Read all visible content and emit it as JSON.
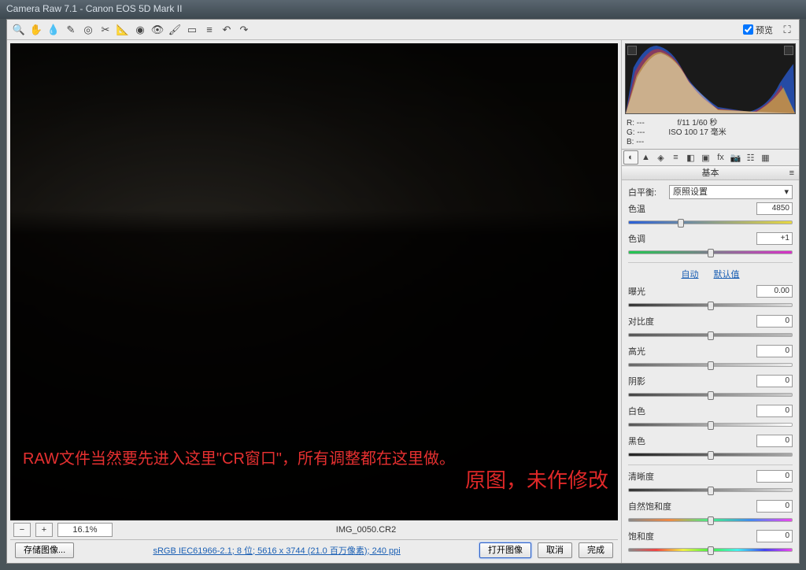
{
  "window_title": "Camera Raw 7.1  -  Canon EOS 5D Mark II",
  "preview_label": "预览",
  "zoom": "16.1%",
  "filename": "IMG_0050.CR2",
  "save_btn": "存储图像...",
  "color_link": "sRGB IEC61966-2.1; 8 位; 5616 x 3744 (21.0 百万像素); 240 ppi",
  "open_btn": "打开图像",
  "cancel_btn": "取消",
  "done_btn": "完成",
  "rgb": {
    "r": "R: ---",
    "g": "G: ---",
    "b": "B: ---"
  },
  "exif": {
    "line1": "f/11  1/60 秒",
    "line2": "ISO 100  17 毫米"
  },
  "panel_title": "基本",
  "wb": {
    "label": "白平衡:",
    "value": "原照设置"
  },
  "temp": {
    "label": "色温",
    "value": "4850"
  },
  "tint": {
    "label": "色调",
    "value": "+1"
  },
  "auto": "自动",
  "default": "默认值",
  "sliders": [
    {
      "label": "曝光",
      "value": "0.00"
    },
    {
      "label": "对比度",
      "value": "0"
    },
    {
      "label": "高光",
      "value": "0"
    },
    {
      "label": "阴影",
      "value": "0"
    },
    {
      "label": "白色",
      "value": "0"
    },
    {
      "label": "黑色",
      "value": "0"
    }
  ],
  "clarity": {
    "label": "清晰度",
    "value": "0"
  },
  "vibrance": {
    "label": "自然饱和度",
    "value": "0"
  },
  "saturation": {
    "label": "饱和度",
    "value": "0"
  },
  "annotation1": "RAW文件当然要先进入这里\"CR窗口\"，所有调整都在这里做。",
  "annotation2": "原图，未作修改"
}
